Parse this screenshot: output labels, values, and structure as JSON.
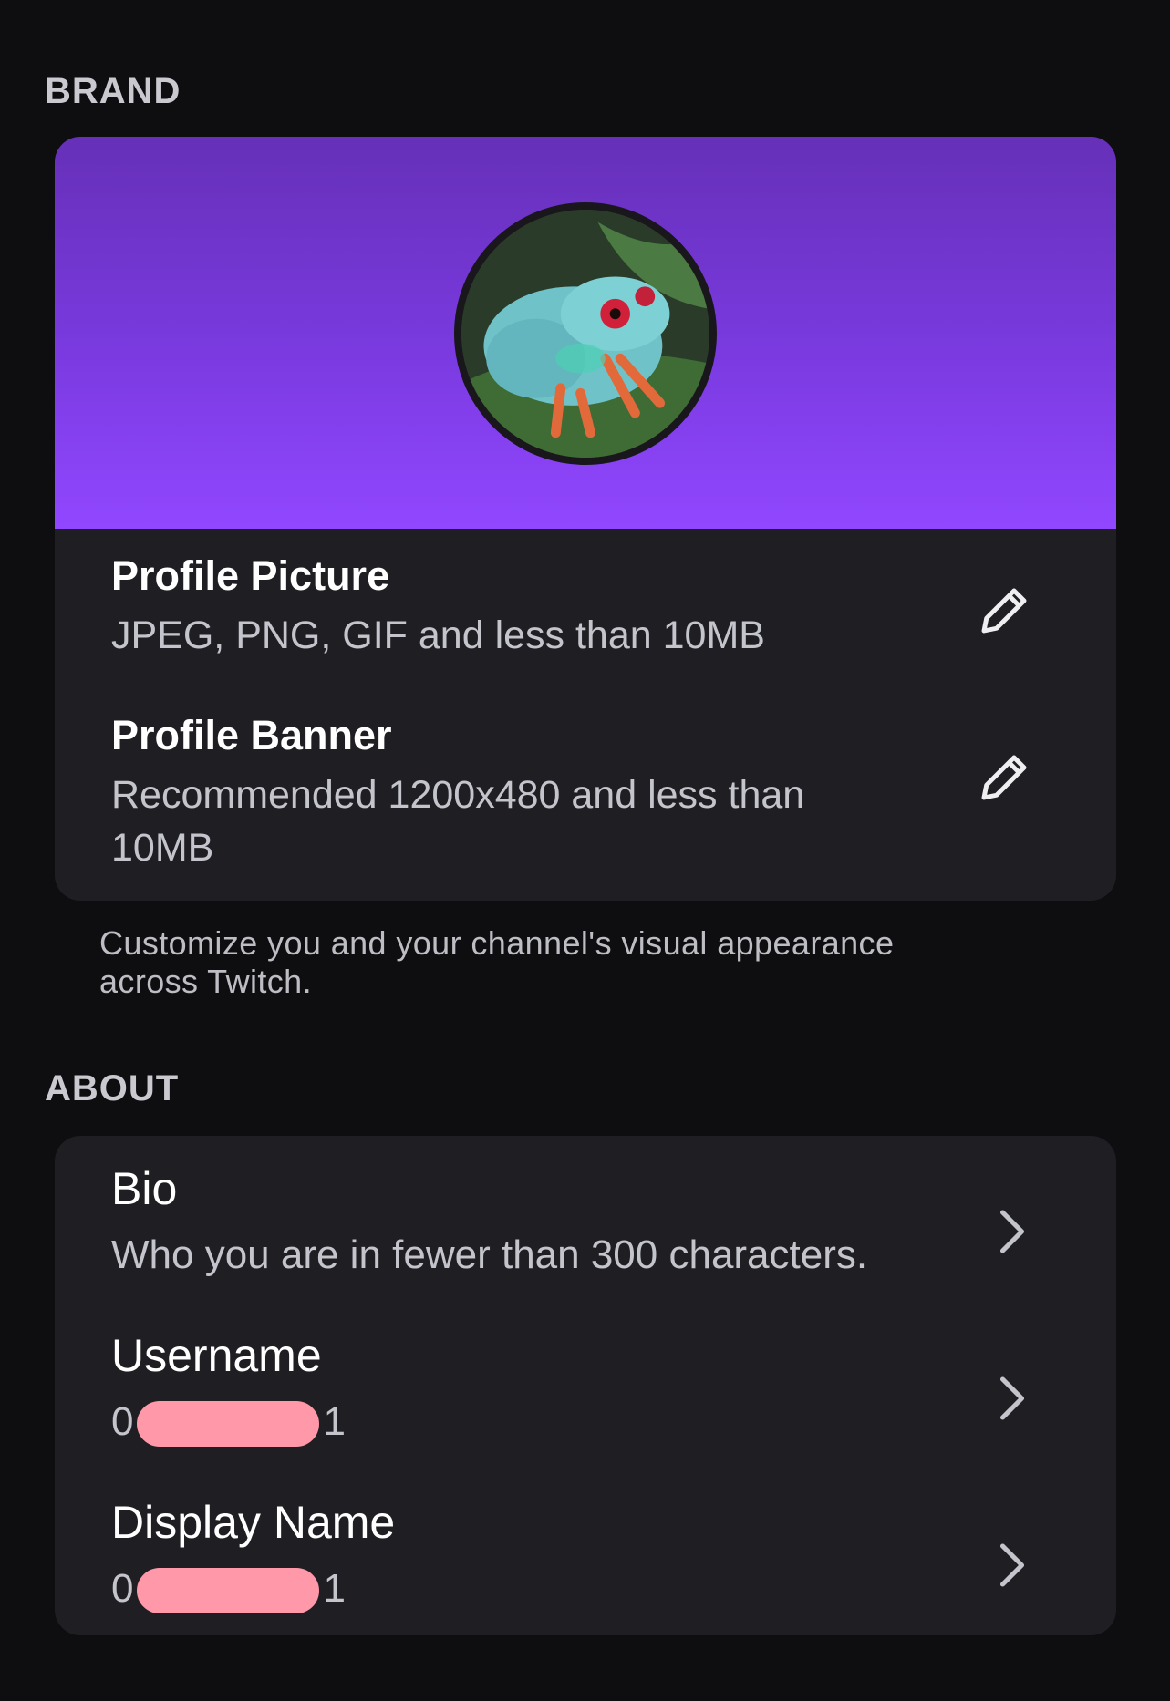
{
  "brand": {
    "section_title": "BRAND",
    "profile_picture": {
      "title": "Profile Picture",
      "subtitle": "JPEG, PNG, GIF and less than 10MB",
      "icon": "pencil-icon"
    },
    "profile_banner": {
      "title": "Profile Banner",
      "subtitle": "Recommended 1200x480 and less than 10MB",
      "icon": "pencil-icon"
    },
    "helper_text": "Customize you and your channel's visual appearance across Twitch."
  },
  "about": {
    "section_title": "ABOUT",
    "bio": {
      "title": "Bio",
      "subtitle": "Who you are in fewer than 300 characters.",
      "icon": "chevron-right-icon"
    },
    "username": {
      "title": "Username",
      "value_prefix": "0",
      "value_suffix": "1",
      "icon": "chevron-right-icon"
    },
    "display_name": {
      "title": "Display Name",
      "value_prefix": "0",
      "value_suffix": "1",
      "icon": "chevron-right-icon"
    }
  },
  "colors": {
    "background": "#0e0e10",
    "card": "#1f1f23",
    "banner_top": "#6630b8",
    "banner_bottom": "#9147ff",
    "redaction": "#ff98a8"
  }
}
